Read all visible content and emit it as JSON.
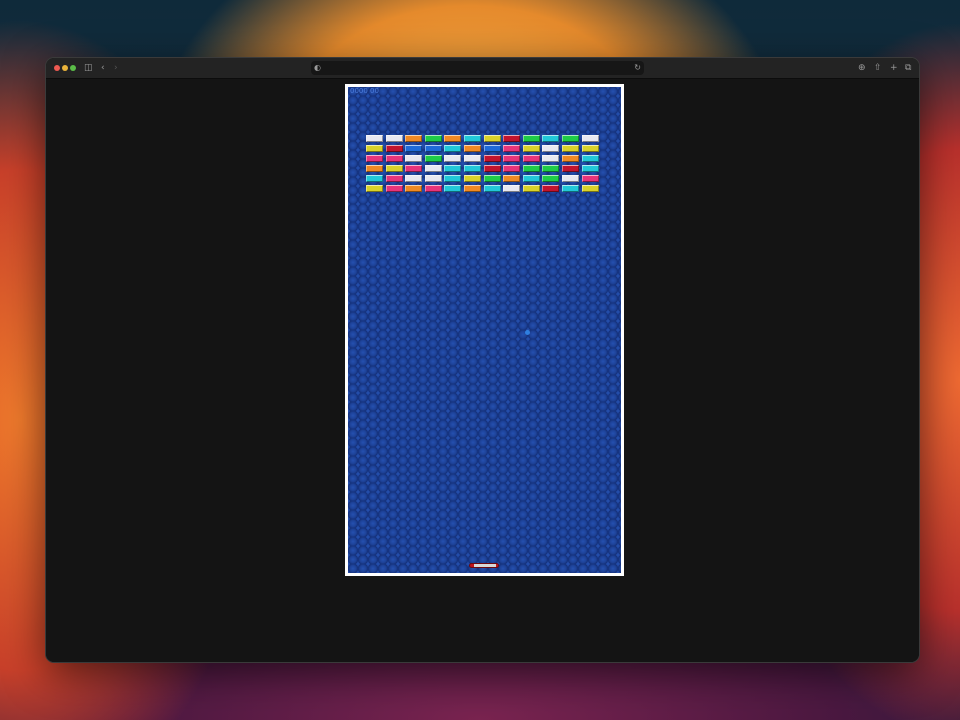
{
  "browser": {
    "icons": {
      "sidebar": "sidebar-icon",
      "back": "chevron-left-icon",
      "forward": "chevron-right-icon",
      "shield": "shield-icon",
      "reload": "reload-icon",
      "download": "download-icon",
      "share": "share-icon",
      "new_tab": "plus-icon",
      "tabs": "tabs-overview-icon"
    }
  },
  "game": {
    "name": "breakout",
    "score_text": "0000 00",
    "brick_colors": {
      "W": "#e8e8f0",
      "Y": "#d9d22a",
      "O": "#f08a24",
      "G": "#1fcc48",
      "C": "#22c8d8",
      "R": "#c2142e",
      "P": "#e8347a",
      "B": "#1e6ad8"
    },
    "brick_rows": [
      "WWOGOCYRGCGW",
      "YRBBCOBPYWYY",
      "PPWGWWRPPWOC",
      "OYPWCCRPGGRC",
      "CPWWCYGOCGWP",
      "YPOPCOCWYRCY"
    ],
    "ball_color": "#2f7fe0",
    "paddle_color": "#c0141c"
  }
}
